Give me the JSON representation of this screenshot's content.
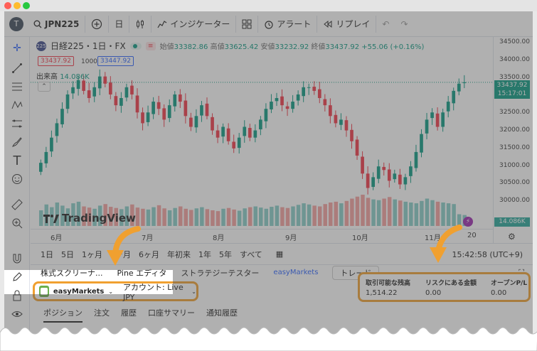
{
  "window": {
    "dot_colors": [
      "#ff5f57",
      "#febc2e",
      "#28c840"
    ]
  },
  "toolbar": {
    "avatar_letter": "T",
    "symbol": "JPN225",
    "interval": "日",
    "indicators_label": "インジケーター",
    "alert_label": "アラート",
    "replay_label": "リプレイ"
  },
  "legend": {
    "badge": "225",
    "title": "日経225・1日・FX",
    "open_label": "始値",
    "open_value": "33382.86",
    "high_label": "高値",
    "high_value": "33625.42",
    "low_label": "安値",
    "low_value": "33232.92",
    "close_label": "終値",
    "close_value": "33437.92",
    "change": "+55.06 (+0.16%)",
    "bid_price": "33437.92",
    "lot": "1000",
    "ask_price": "33447.92",
    "volume_label": "出来高",
    "volume_value": "14.086K"
  },
  "price_scale": {
    "labels": [
      "34500.00",
      "34000.00",
      "33500.00",
      "33000.00",
      "32500.00",
      "32000.00",
      "31500.00",
      "31000.00",
      "30500.00",
      "30000.00"
    ],
    "current_price": "33437.92",
    "current_time": "15:17:01",
    "volume_tag": "14.086K"
  },
  "time_axis": {
    "labels": [
      "6月",
      "7月",
      "8月",
      "9月",
      "10月",
      "11月",
      "20"
    ]
  },
  "watermark": "TradingView",
  "ranges": {
    "items": [
      "1日",
      "5日",
      "1ヶ月",
      "3ヶ月",
      "6ヶ月",
      "年初来",
      "1年",
      "5年",
      "すべて"
    ],
    "clock": "15:42:58 (UTC+9)"
  },
  "panel_tabs": {
    "screener": "株式スクリーナ...",
    "pine": "Pine エディタ",
    "tester": "ストラテジーテスター",
    "broker": "easyMarkets",
    "trade": "トレード"
  },
  "account": {
    "broker": "easyMarkets",
    "account_label": "アカウント: Live JPY"
  },
  "stats": {
    "available_label": "取引可能な残高",
    "available_value": "1,514.22",
    "risk_label": "リスクにある金額",
    "risk_value": "0.00",
    "pl_label": "オープンP/L",
    "pl_value": "0.00"
  },
  "sub_tabs": [
    "ポジション",
    "注文",
    "履歴",
    "口座サマリー",
    "通知履歴"
  ],
  "colors": {
    "up": "#089981",
    "down": "#f23645",
    "accent": "#f0a030",
    "link": "#2962ff"
  },
  "chart_data": {
    "type": "candlestick",
    "x_labels": [
      "6月",
      "7月",
      "8月",
      "9月",
      "10月",
      "11月",
      "20"
    ],
    "ylim": [
      29800,
      34600
    ],
    "close_series": [
      31200,
      31500,
      31900,
      32300,
      32700,
      33100,
      33300,
      33500,
      33200,
      33000,
      33300,
      33600,
      33400,
      33100,
      32800,
      33000,
      33300,
      33100,
      32600,
      32300,
      32600,
      32900,
      32700,
      32400,
      32800,
      33100,
      32900,
      32500,
      32200,
      32500,
      32800,
      32500,
      32100,
      31900,
      32200,
      31800,
      31600,
      31900,
      32200,
      31900,
      32100,
      32400,
      32700,
      32900,
      33000,
      32800,
      32700,
      32900,
      33100,
      33300,
      33300,
      33200,
      33000,
      32800,
      32500,
      32300,
      32400,
      32100,
      31800,
      31400,
      30900,
      30500,
      30800,
      31100,
      31000,
      30700,
      30900,
      30600,
      30800,
      31100,
      31500,
      32000,
      32400,
      32600,
      32200,
      32600,
      32900,
      33200,
      33400,
      33437.92
    ],
    "volume_series": [
      40,
      55,
      48,
      60,
      52,
      45,
      58,
      62,
      50,
      47,
      44,
      52,
      56,
      49,
      46,
      43,
      50,
      55,
      47,
      44,
      42,
      48,
      53,
      45,
      40,
      46,
      50,
      44,
      41,
      45,
      48,
      43,
      40,
      38,
      44,
      46,
      42,
      39,
      45,
      48,
      50,
      47,
      44,
      49,
      52,
      48,
      46,
      50,
      54,
      58,
      55,
      52,
      50,
      56,
      60,
      62,
      58,
      64,
      70,
      75,
      80,
      72,
      68,
      66,
      70,
      74,
      68,
      65,
      62,
      60,
      58,
      64,
      70,
      66,
      62,
      60,
      58,
      56,
      30,
      28
    ]
  }
}
